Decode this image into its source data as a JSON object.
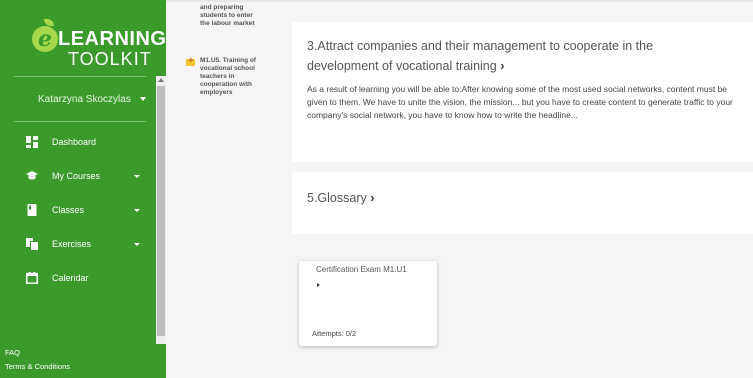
{
  "logo": {
    "learning": "LEARNING",
    "toolkit": "TOOLKIT"
  },
  "user": {
    "name": "Katarzyna Skoczylas"
  },
  "nav": [
    {
      "label": "Dashboard",
      "icon": "dashboard-icon",
      "has_caret": false
    },
    {
      "label": "My Courses",
      "icon": "graduation-cap-icon",
      "has_caret": true
    },
    {
      "label": "Classes",
      "icon": "book-icon",
      "has_caret": true
    },
    {
      "label": "Exercises",
      "icon": "copy-icon",
      "has_caret": true
    },
    {
      "label": "Calendar",
      "icon": "calendar-icon",
      "has_caret": false
    }
  ],
  "footer": {
    "faq": "FAQ",
    "terms": "Terms & Conditions"
  },
  "toc": {
    "prev_lines": [
      "and preparing",
      "students to enter",
      "the labour market"
    ],
    "item_lines": [
      "M1.U5. Training of",
      "vocational school",
      "teachers in",
      "cooperation with",
      "employers"
    ]
  },
  "sections": {
    "s3": {
      "title_line1": "3.Attract companies and their management to cooperate in the",
      "title_line2": "development of vocational training",
      "chevron": "›",
      "body": "As a result of learning you will be able to:After knowing some of the most used social networks, content must be given to them. We have to unite the vision, the mission... but you have to create content to generate traffic to your company's social network, you have to know how to write the headline..."
    },
    "s5": {
      "title": "5.Glossary",
      "chevron": "›"
    }
  },
  "exam": {
    "title": "Certification Exam M1.U1",
    "attempts": "Attempts: 0/2"
  },
  "colors": {
    "sidebar": "#3a9a2a",
    "logo_accent": "#a6d84b",
    "toc_icon": "#f4c430"
  }
}
